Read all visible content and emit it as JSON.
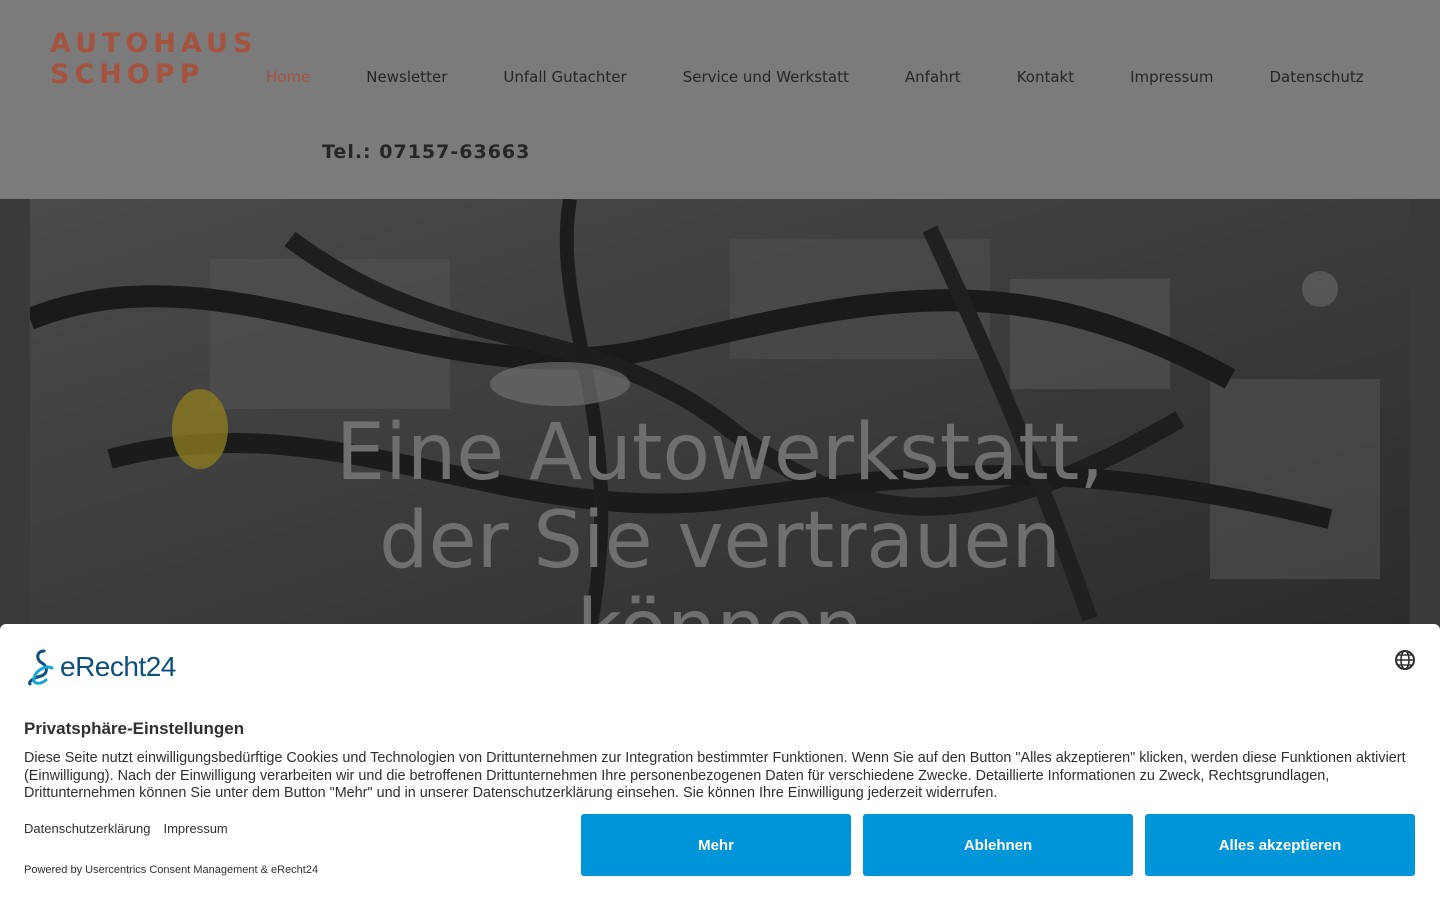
{
  "header": {
    "logo_line1": "AUTOHAUS",
    "logo_line2": "SCHOPP",
    "nav": [
      {
        "label": "Home"
      },
      {
        "label": "Newsletter"
      },
      {
        "label": "Unfall Gutachter"
      },
      {
        "label": "Service und Werkstatt"
      },
      {
        "label": "Anfahrt"
      },
      {
        "label": "Kontakt"
      },
      {
        "label": "Impressum"
      },
      {
        "label": "Datenschutz"
      }
    ],
    "active_nav": "Home",
    "phone": "Tel.: 07157-63663"
  },
  "hero": {
    "line1": "Eine Autowerkstatt,",
    "line2": "der Sie vertrauen",
    "line3": "können"
  },
  "consent": {
    "brand": "eRecht24",
    "title": "Privatsphäre-Einstellungen",
    "text": "Diese Seite nutzt einwilligungsbedürftige Cookies und Technologien von Drittunternehmen zur Integration bestimmter Funktionen. Wenn Sie auf den Button \"Alles akzeptieren\" klicken, werden diese Funktionen aktiviert (Einwilligung). Nach der Einwilligung verarbeiten wir und die betroffenen Drittunternehmen Ihre personenbezogenen Daten für verschiedene Zwecke. Detaillierte Informationen zu Zweck, Rechtsgrundlagen, Drittunternehmen können Sie unter dem Button \"Mehr\" und in unserer Datenschutzerklärung einsehen. Sie können Ihre Einwilligung jederzeit widerrufen.",
    "link_privacy": "Datenschutzerklärung",
    "link_imprint": "Impressum",
    "powered": "Powered by Usercentrics Consent Management & eRecht24",
    "btn_more": "Mehr",
    "btn_decline": "Ablehnen",
    "btn_accept": "Alles akzeptieren"
  },
  "colors": {
    "accent": "#a5523f",
    "button": "#0094d9",
    "brand": "#0d4f7d"
  }
}
